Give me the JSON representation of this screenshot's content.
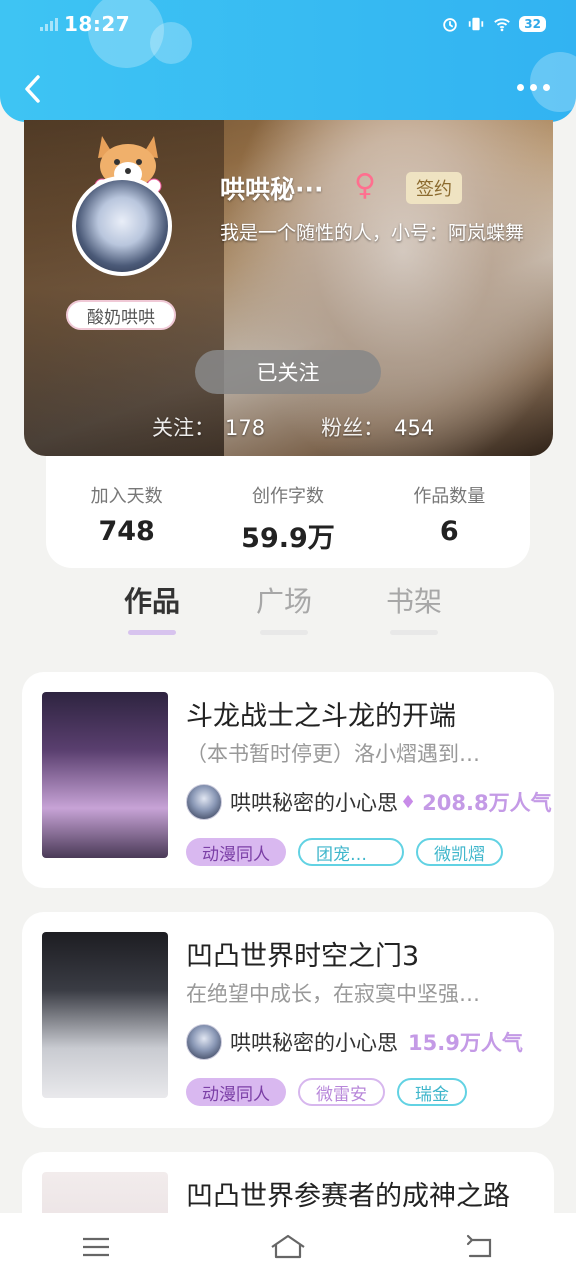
{
  "status_bar": {
    "time": "18:27",
    "battery": "32"
  },
  "profile": {
    "name": "哄哄秘···",
    "gender_symbol": "♀",
    "sign_badge": "签约",
    "bio": "我是一个随性的人，小号：阿岚蝶舞",
    "avatar_tag": "酸奶哄哄",
    "follow_button": "已关注",
    "following_label": "关注：",
    "following_count": "178",
    "fans_label": "粉丝：",
    "fans_count": "454"
  },
  "stats": [
    {
      "label": "加入天数",
      "value": "748"
    },
    {
      "label": "创作字数",
      "value": "59.9万"
    },
    {
      "label": "作品数量",
      "value": "6"
    }
  ],
  "tabs": [
    {
      "label": "作品",
      "active": true
    },
    {
      "label": "广场",
      "active": false
    },
    {
      "label": "书架",
      "active": false
    }
  ],
  "works": [
    {
      "title": "斗龙战士之斗龙的开端",
      "desc": "（本书暂时停更）洛小熠遇到…",
      "author": "哄哄秘密的小心思",
      "popularity": "208.8万人气",
      "tags": [
        "动漫同人",
        "团宠…",
        "微凯熠"
      ]
    },
    {
      "title": "凹凸世界时空之门3",
      "desc": "在绝望中成长，在寂寞中坚强…",
      "author": "哄哄秘密的小心思",
      "popularity": "15.9万人气",
      "tags": [
        "动漫同人",
        "微雷安",
        "瑞金"
      ]
    },
    {
      "title": "凹凸世界参赛者的成神之路"
    }
  ],
  "icons": {
    "back": "back-arrow-icon",
    "more": "more-dots-icon",
    "hot": "flame-icon",
    "nav": [
      "menu-icon",
      "home-icon",
      "back-nav-icon"
    ]
  },
  "colors": {
    "header": "#3ec4f3",
    "accent_purple": "#c49ae6",
    "tag_cyan": "#62d2e3"
  }
}
